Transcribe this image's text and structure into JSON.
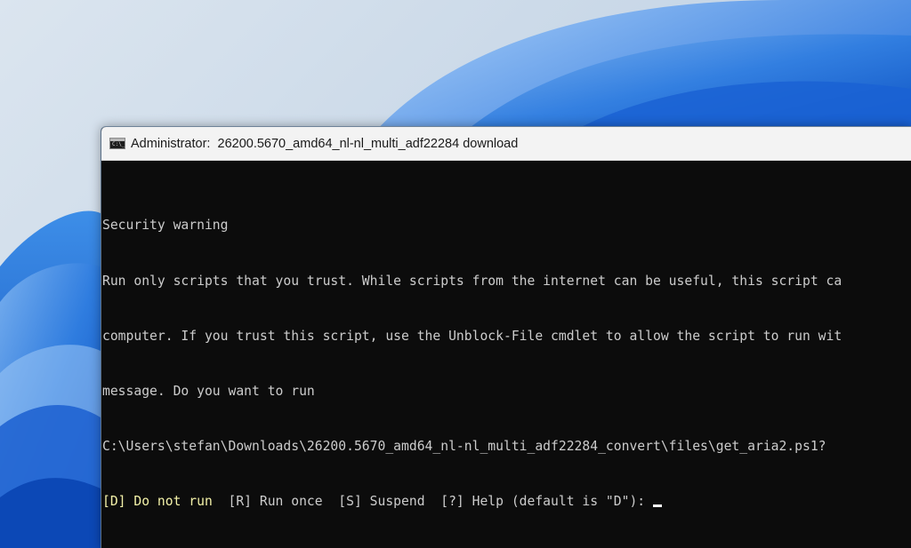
{
  "window": {
    "title": "Administrator:  26200.5670_amd64_nl-nl_multi_adf22284 download",
    "icon": "cmd-icon",
    "icon_text": "C:\\_"
  },
  "console": {
    "heading": "Security warning",
    "lines": [
      "Run only scripts that you trust. While scripts from the internet can be useful, this script ca",
      "computer. If you trust this script, use the Unblock-File cmdlet to allow the script to run wit",
      "message. Do you want to run",
      "C:\\Users\\stefan\\Downloads\\26200.5670_amd64_nl-nl_multi_adf22284_convert\\files\\get_aria2.ps1?"
    ],
    "prompt_highlight": "[D] Do not run",
    "prompt_rest": "  [R] Run once  [S] Suspend  [?] Help (default is \"D\"):",
    "text_color": "#cccccc",
    "prompt_color": "#f3f1a8",
    "background_color": "#0c0c0c"
  },
  "desktop": {
    "wallpaper": "windows-11-bloom-blue"
  }
}
